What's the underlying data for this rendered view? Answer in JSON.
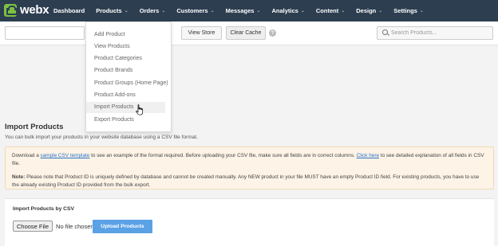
{
  "brand": {
    "name": "webx"
  },
  "nav": {
    "items": [
      {
        "label": "Dashboard",
        "has_menu": false
      },
      {
        "label": "Products",
        "has_menu": true
      },
      {
        "label": "Orders",
        "has_menu": true
      },
      {
        "label": "Customers",
        "has_menu": true
      },
      {
        "label": "Messages",
        "has_menu": true
      },
      {
        "label": "Analytics",
        "has_menu": true
      },
      {
        "label": "Content",
        "has_menu": true
      },
      {
        "label": "Design",
        "has_menu": true
      },
      {
        "label": "Settings",
        "has_menu": true
      }
    ],
    "chevron": "⌄"
  },
  "toolbar": {
    "url_value": "",
    "view_store_label": "View Store",
    "clear_cache_label": "Clear Cache",
    "help_glyph": "?",
    "search_placeholder": "Search Products..."
  },
  "products_menu": {
    "items": [
      "Add Product",
      "View Products",
      "Product Categories",
      "Product Brands",
      "Product Groups (Home Page)",
      "Product Add-ons",
      "Import Products",
      "Export Products"
    ],
    "hovered_index": 6
  },
  "main": {
    "title": "Import Products",
    "description": "You can bulk import your products in your website database using a CSV file format.",
    "notice": {
      "line1_pre": "Download a ",
      "line1_link1": "sample CSV template",
      "line1_mid": " to see an example of the format required. Before uploading your CSV file, make sure all fields are in correct columns. ",
      "line1_link2": "Click here",
      "line1_post": " to see detailed explanation of all fields in CSV file.",
      "note_label": "Note:",
      "note_text": " Please note that Product ID is uniquely defined by database and cannot be created manually. Any NEW product in your file MUST have an empty Product ID field. For existing products, you have to use the already existing Product ID provided from the bulk export."
    },
    "import_card": {
      "title": "Import Products by CSV",
      "choose_file_label": "Choose File",
      "no_file_text": "No file chosen",
      "upload_label": "Upload Products"
    }
  },
  "colors": {
    "nav_bg": "#2d3e50",
    "brand_green": "#7bc142",
    "upload_blue": "#5aa1e6",
    "notice_bg": "#fdf3e6",
    "link": "#2a73c9"
  }
}
